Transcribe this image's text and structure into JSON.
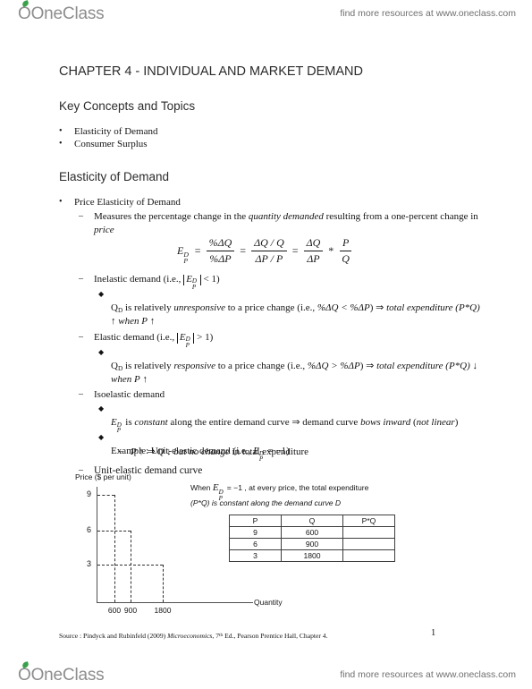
{
  "banner": {
    "logo_text_one": "One",
    "logo_text_class": "Class",
    "logo_o": "O",
    "tagline": "find more resources at www.oneclass.com"
  },
  "document": {
    "chapter_title": "CHAPTER 4 - INDIVIDUAL AND MARKET DEMAND",
    "key_concepts_heading": "Key Concepts and Topics",
    "key_concepts": [
      "Elasticity of Demand",
      "Consumer Surplus"
    ],
    "elasticity_heading": "Elasticity of Demand",
    "price_elasticity": {
      "bullet": "Price Elasticity of Demand",
      "measures_pre": "Measures the percentage change in the ",
      "measures_italic": "quantity demanded",
      "measures_mid": " resulting from a one-percent change in ",
      "measures_italic2": "price"
    },
    "formula": {
      "lead_E": "E",
      "lead_sup": "D",
      "lead_sub": "P",
      "equals": "=",
      "f1_num": "%ΔQ",
      "f1_den": "%ΔP",
      "f2_num": "ΔQ / Q",
      "f2_den": "ΔP / P",
      "f3_num": "ΔQ",
      "f3_den": "ΔP",
      "star": "*",
      "f4_num": "P",
      "f4_den": "Q"
    },
    "inelastic": {
      "heading_pre": "Inelastic demand (i.e., ",
      "abs_E": "E",
      "abs_sup": "D",
      "abs_sub": "P",
      "heading_post": " < 1)",
      "detail_pre": "Q",
      "detail_sub": "D",
      "detail_1": " is relatively ",
      "detail_italic": "unresponsive",
      "detail_2": " to a price change (i.e., ",
      "detail_math": "%ΔQ < %ΔP",
      "detail_3": ") ⇒ ",
      "detail_italic2": "total expenditure",
      "detail_4": " (P*Q) ↑ when ",
      "detail_italic3": "P",
      "detail_5": " ↑"
    },
    "elastic": {
      "heading_pre": "Elastic demand (i.e., ",
      "abs_E": "E",
      "abs_sup": "D",
      "abs_sub": "P",
      "heading_post": " > 1)",
      "detail_pre": "Q",
      "detail_sub": "D",
      "detail_1": " is relatively ",
      "detail_italic": "responsive",
      "detail_2": " to a price change (i.e., ",
      "detail_math": "%ΔQ > %ΔP",
      "detail_3": ") ⇒ ",
      "detail_italic2": "total expenditure",
      "detail_4": " (P*Q) ↓ when ",
      "detail_italic3": "P",
      "detail_5": " ↑"
    },
    "isoelastic": {
      "heading": "Isoelastic demand",
      "point1_E": "E",
      "point1_sup": "D",
      "point1_sub": "P",
      "point1_a": " is ",
      "point1_italic": "constant",
      "point1_b": " along the entire demand curve ⇒ demand curve ",
      "point1_italic2": "bows inward",
      "point1_c": " (",
      "point1_italic3": "not linear",
      "point1_d": ")",
      "point2_a": "Example: Unit-elastic demand (i.e., ",
      "point2_E": "E",
      "point2_sup": "D",
      "point2_sub": "P",
      "point2_b": " = −1)",
      "point3_a": "P ↑ ⇒ Q ↓ but ",
      "point3_italic": "no change",
      "point3_b": " in total expenditure"
    },
    "unit_elastic_curve_heading": "Unit-elastic demand curve",
    "graph_annotation": {
      "line1_a": "When ",
      "line1_E": "E",
      "line1_sup": "D",
      "line1_sub": "P",
      "line1_b": " = −1 , at every price, the total expenditure",
      "line2": "(P*Q) is constant along the demand curve D"
    },
    "source": {
      "prefix": "Source : Pindyck and Rubinfeld (2009) ",
      "italic_title": "Microeconomics",
      "mid": ", 7",
      "sup": "th",
      "suffix": " Ed., Pearson Prentice Hall, Chapter 4."
    },
    "page_number": "1"
  },
  "chart_data": {
    "type": "line",
    "title": "Unit-elastic demand curve",
    "xlabel": "Quantity",
    "ylabel": "Price ($ per unit)",
    "x_ticks": [
      "600",
      "900",
      "1800"
    ],
    "y_ticks": [
      "9",
      "6",
      "3"
    ],
    "x_values": [
      600,
      900,
      1800
    ],
    "y_values": [
      9,
      6,
      3
    ],
    "curve_label": "D",
    "grid": false,
    "style": "dashed-step",
    "note": "Rectangles drawn with dashed lines showing constant P*Q = 5400 at each price point",
    "table": {
      "columns": [
        "P",
        "Q",
        "P*Q"
      ],
      "rows": [
        [
          "9",
          "600",
          ""
        ],
        [
          "6",
          "900",
          ""
        ],
        [
          "3",
          "1800",
          ""
        ]
      ]
    }
  }
}
